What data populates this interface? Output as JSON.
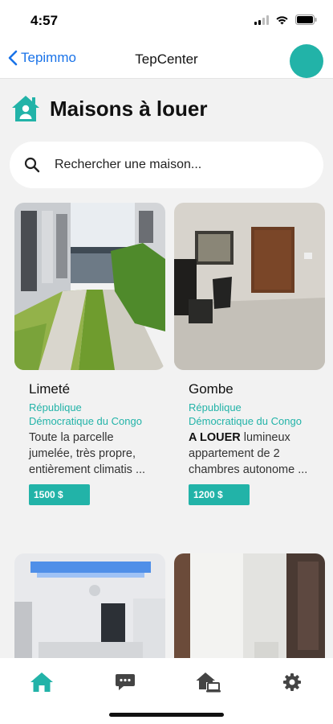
{
  "status_bar": {
    "time": "4:57"
  },
  "nav": {
    "back_label": "Tepimmo",
    "title": "TepCenter"
  },
  "header": {
    "title": "Maisons à louer"
  },
  "search": {
    "placeholder": "Rechercher une maison..."
  },
  "listings": [
    {
      "name": "Limeté",
      "country": "République Démocratique du Congo",
      "description": "Toute la parcelle jumelée, très propre, entièrement climatis ...",
      "price": "1500 $"
    },
    {
      "name": "Gombe",
      "country": "République Démocratique du Congo",
      "description_bold": "A LOUER",
      "description": " lumineux appartement de 2 chambres autonome ...",
      "price": "1200 $"
    }
  ],
  "tabs": [
    {
      "icon": "home-icon",
      "active": true
    },
    {
      "icon": "chat-icon",
      "active": false
    },
    {
      "icon": "house-laptop-icon",
      "active": false
    },
    {
      "icon": "gear-icon",
      "active": false
    }
  ],
  "colors": {
    "accent": "#22b3a8",
    "link": "#1a73e8",
    "inactive_icon": "#444444"
  }
}
